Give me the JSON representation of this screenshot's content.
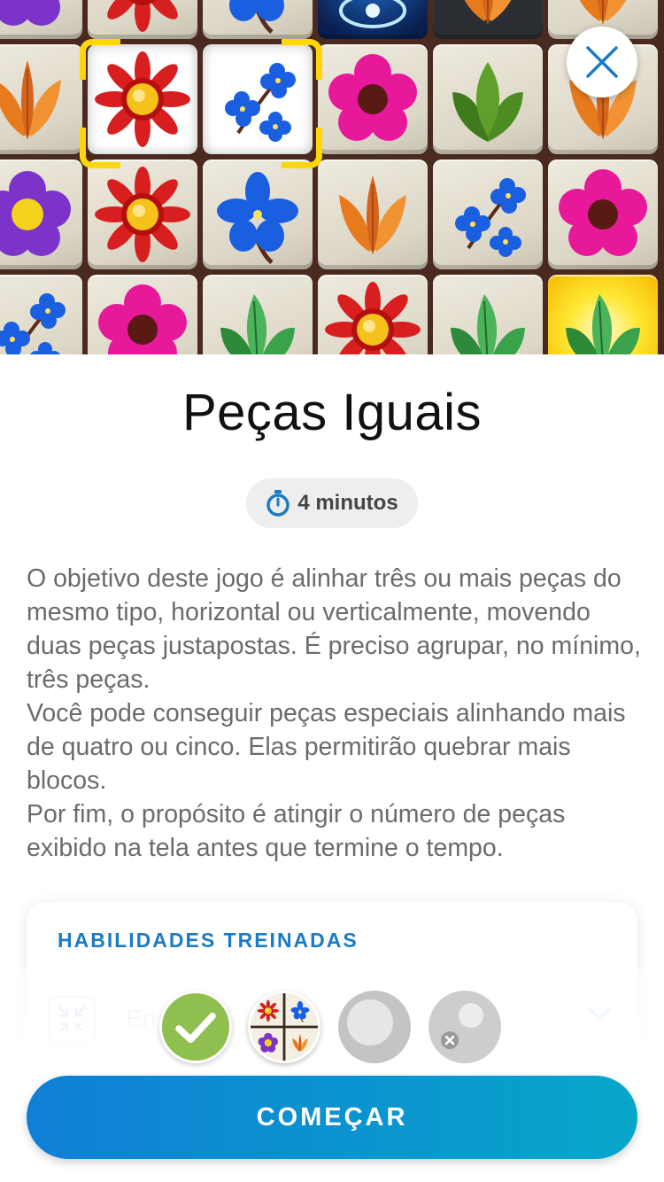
{
  "game": {
    "title": "Peças Iguais",
    "duration": "4 minutos",
    "description": [
      "O objetivo deste jogo é alinhar três ou mais peças do mesmo tipo, horizontal ou verticalmente, movendo duas peças justapostas. É preciso agrupar, no mínimo, três peças.",
      "Você pode conseguir peças especiais alinhando mais de quatro ou cinco. Elas permitirão quebrar mais blocos.",
      "Por fim, o propósito é atingir o número de peças exibido na tela antes que termine o tempo."
    ]
  },
  "skills": {
    "heading": "HABILIDADES TREINADAS",
    "items": [
      {
        "label": "En",
        "icon": "focus-arrows-icon"
      }
    ]
  },
  "progress": [
    {
      "state": "done",
      "icon": "checkmark-icon"
    },
    {
      "state": "current",
      "icon": "flower-tiles-icon"
    },
    {
      "state": "upcoming",
      "icon": "circle-icon"
    },
    {
      "state": "locked",
      "icon": "locked-circle-icon"
    }
  ],
  "actions": {
    "start_label": "COMEÇAR",
    "close_icon": "close-icon"
  },
  "colors": {
    "accent": "#1a7bc7",
    "button_gradient_start": "#0f7fd6",
    "button_gradient_end": "#07a6c9",
    "done": "#8fc04f",
    "selection": "#ffd60a"
  }
}
